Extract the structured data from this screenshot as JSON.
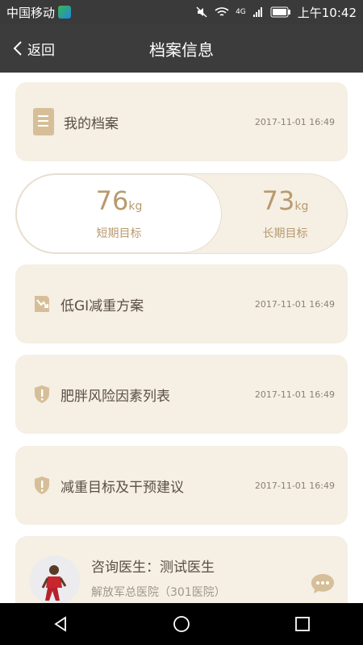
{
  "status_bar": {
    "carrier": "中国移动",
    "time": "上午10:42",
    "network": "4G"
  },
  "header": {
    "back_label": "返回",
    "title": "档案信息"
  },
  "profile_card": {
    "label": "我的档案",
    "date": "2017-11-01 16:49",
    "icon": "document-icon"
  },
  "goals": {
    "short": {
      "value": "76",
      "unit": "kg",
      "caption": "短期目标"
    },
    "long": {
      "value": "73",
      "unit": "kg",
      "caption": "长期目标"
    }
  },
  "items": [
    {
      "label": "低GI减重方案",
      "date": "2017-11-01 16:49",
      "icon": "trend-down-icon"
    },
    {
      "label": "肥胖风险因素列表",
      "date": "2017-11-01 16:49",
      "icon": "shield-alert-icon"
    },
    {
      "label": "减重目标及干预建议",
      "date": "2017-11-01 16:49",
      "icon": "shield-alert-icon"
    }
  ],
  "doctor": {
    "name": "咨询医生：测试医生",
    "hospital": "解放军总医院（301医院）"
  },
  "colors": {
    "card_bg": "#f5efe4",
    "accent": "#b89a6f",
    "icon_tan": "#d6bf98",
    "header_bg": "#3c3c3c"
  }
}
